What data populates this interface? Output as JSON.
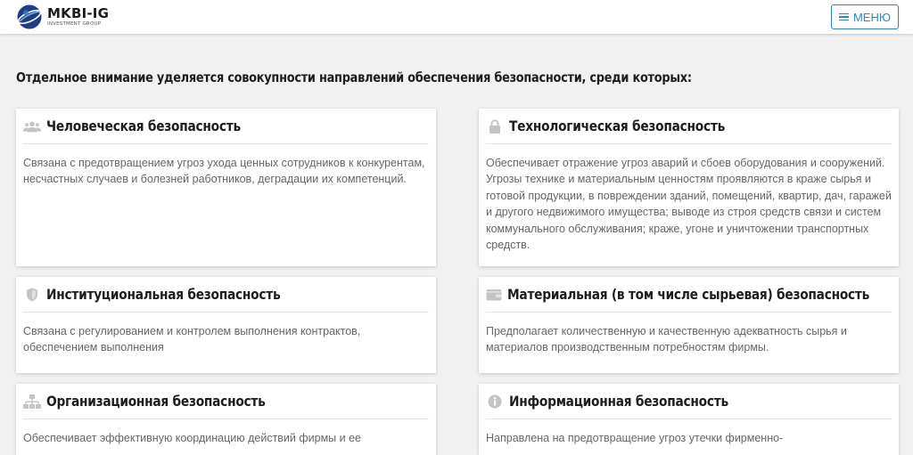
{
  "header": {
    "logo_name": "MKBI-IG",
    "logo_sub": "INVESTMENT GROUP",
    "menu_label": "МЕНЮ"
  },
  "intro": "Отдельное внимание уделяется совокупности направлений обеспечения безопасности, среди которых:",
  "colors": {
    "accent": "#2b86c5",
    "icon_gray": "#c4c4c4",
    "background": "#f1f1f1"
  },
  "cards": [
    {
      "icon": "users-icon",
      "title": "Человеческая безопасность",
      "text": "Связана с предотвращением угроз ухода ценных сотрудников к конкурентам, несчастных случаев и болезней работников, деградации их компетенций."
    },
    {
      "icon": "lock-icon",
      "title": "Технологическая безопасность",
      "text": "Обеспечивает отражение угроз аварий и сбоев оборудования и сооружений. Угрозы технике и материальным ценностям проявляются в краже сырья и готовой продукции, в повреждении зданий, помещений, квартир, дач, гаражей и другого недвижимого имущества; выводе из строя средств связи и систем коммунального обслуживания; краже, угоне и уничтожении транспортных средств."
    },
    {
      "icon": "shield-icon",
      "title": "Институциональная безопасность",
      "text": "Связана с регулированием и контролем выполнения контрактов, обеспечением выполнения"
    },
    {
      "icon": "wallet-icon",
      "title": "Материальная (в том числе сырьевая) безопасность",
      "text": "Предполагает количественную и качественную адекватность сырья и материалов производственным потребностям фирмы."
    },
    {
      "icon": "sitemap-icon",
      "title": "Организационная безопасность",
      "text": "Обеспечивает эффективную координацию действий фирмы и ее"
    },
    {
      "icon": "info-icon",
      "title": "Информационная безопасность",
      "text": "Направлена на предотвращение угроз утечки фирменно-"
    }
  ]
}
